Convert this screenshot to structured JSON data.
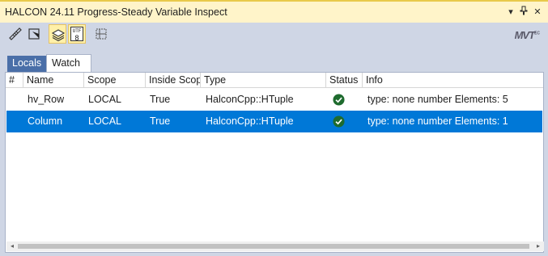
{
  "window": {
    "title": "HALCON 24.11 Progress-Steady Variable Inspect",
    "dropdown_glyph": "▾",
    "pin_glyph": "⊥",
    "close_glyph": "✕"
  },
  "toolbar": {
    "logo_text": "MVT",
    "logo_sup": "EC",
    "utf8_label_top": "UTF",
    "utf8_label_bottom": "8"
  },
  "tabs": [
    {
      "label": "Locals",
      "selected": false
    },
    {
      "label": "Watch",
      "selected": true
    }
  ],
  "table": {
    "columns": [
      "#",
      "Name",
      "Scope",
      "Inside Scope",
      "Type",
      "Status",
      "Info"
    ],
    "rows": [
      {
        "name": "hv_Row",
        "scope": "LOCAL",
        "inside_scope": "True",
        "type": "HalconCpp::HTuple",
        "status": "ok",
        "info": "type: none number Elements: 5",
        "selected": false
      },
      {
        "name": "Column",
        "scope": "LOCAL",
        "inside_scope": "True",
        "type": "HalconCpp::HTuple",
        "status": "ok",
        "info": "type: none number Elements: 1",
        "selected": true
      }
    ]
  },
  "scrollbar": {
    "left_arrow": "◂",
    "right_arrow": "▸"
  },
  "colors": {
    "selection": "#0078d7",
    "status_ok": "#1e6b2e",
    "title_bar": "#fff4c9",
    "tab_inactive": "#4a6fa8"
  }
}
